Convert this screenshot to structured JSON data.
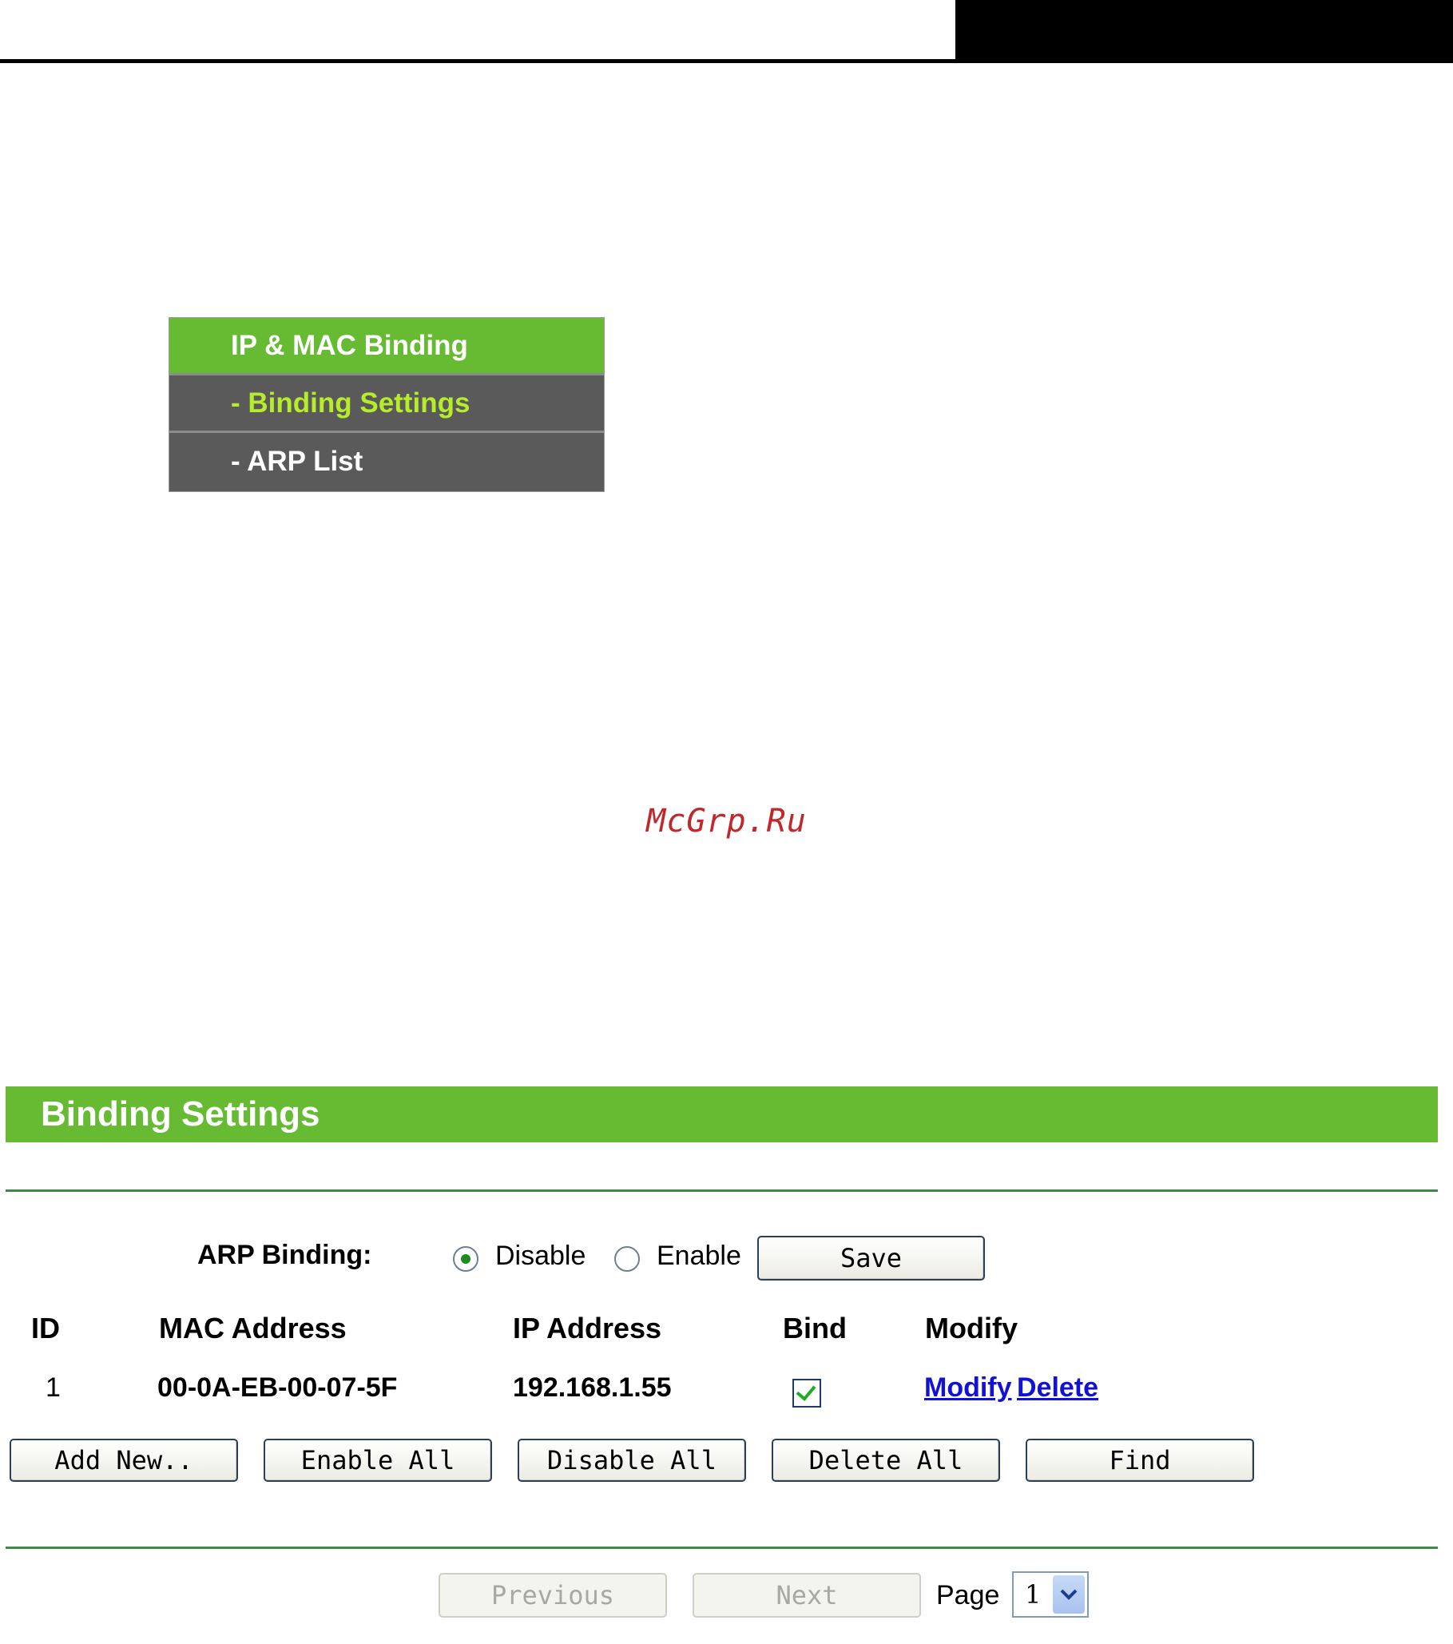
{
  "menu": {
    "items": [
      {
        "label": "IP & MAC Binding"
      },
      {
        "label": "- Binding Settings"
      },
      {
        "label": "- ARP List"
      }
    ]
  },
  "watermark": "McGrp.Ru",
  "panel": {
    "title": "Binding Settings",
    "arp_binding_label": "ARP Binding:",
    "option_disable": "Disable",
    "option_enable": "Enable",
    "selected_option": "Disable",
    "save_label": "Save"
  },
  "table": {
    "headers": {
      "id": "ID",
      "mac": "MAC Address",
      "ip": "IP Address",
      "bind": "Bind",
      "modify": "Modify"
    },
    "rows": [
      {
        "id": "1",
        "mac": "00-0A-EB-00-07-5F",
        "ip": "192.168.1.55",
        "bind": true,
        "modify_link": "Modify",
        "delete_link": "Delete"
      }
    ]
  },
  "actions": {
    "add_new": "Add New..",
    "enable_all": "Enable All",
    "disable_all": "Disable All",
    "delete_all": "Delete All",
    "find": "Find"
  },
  "pagination": {
    "previous": "Previous",
    "next": "Next",
    "page_label": "Page",
    "page_value": "1"
  },
  "colors": {
    "accent_green": "#66bb33",
    "menu_bg": "#5a5a5a",
    "active_text": "#b7ec2a",
    "link_blue": "#1212d6"
  }
}
